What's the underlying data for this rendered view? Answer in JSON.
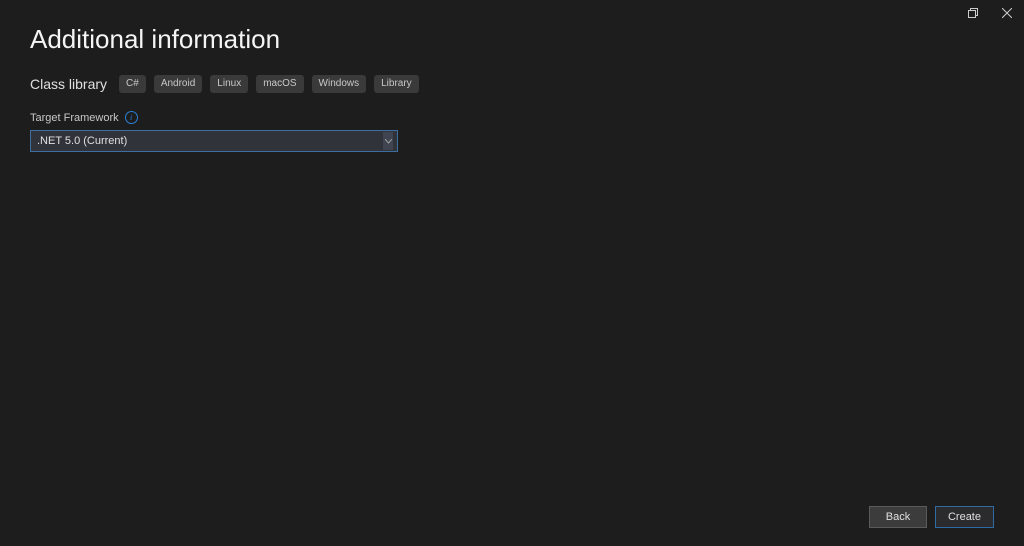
{
  "header": {
    "title": "Additional information"
  },
  "template": {
    "name": "Class library",
    "tags": [
      "C#",
      "Android",
      "Linux",
      "macOS",
      "Windows",
      "Library"
    ]
  },
  "field": {
    "label": "Target Framework",
    "selected": ".NET 5.0 (Current)"
  },
  "footer": {
    "back": "Back",
    "create": "Create"
  }
}
